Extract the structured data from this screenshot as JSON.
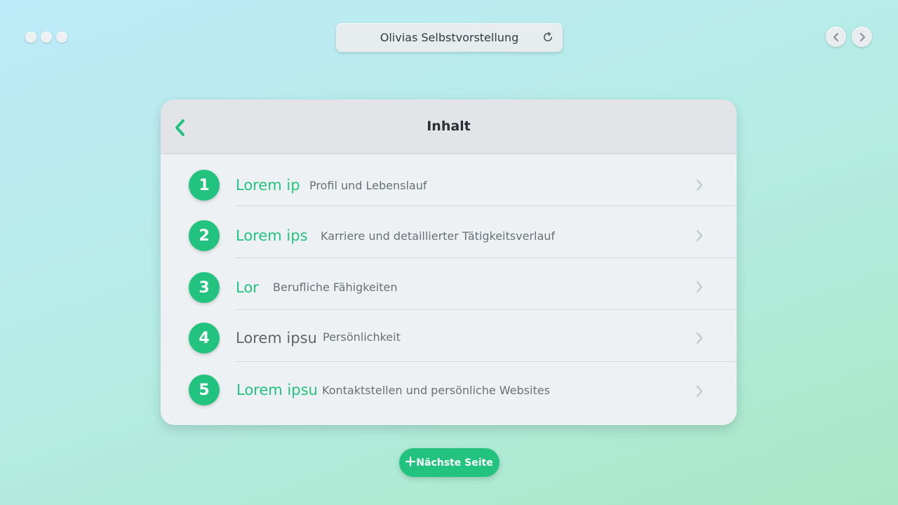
{
  "window": {
    "title": "Olivias Selbstvorstellung"
  },
  "icons": {
    "refresh": "refresh-icon",
    "back": "chevron-left-icon",
    "forward": "chevron-right-icon",
    "row_chevron": "chevron-right-icon",
    "next_plus": "plus-icon"
  },
  "colors": {
    "accent": "#22c37f",
    "header_bg": "#e3e4e8",
    "card_bg": "#edf1f3"
  },
  "card": {
    "title": "Inhalt",
    "items": [
      {
        "number": "1",
        "title": "Lorem ip",
        "description": "Profil und Lebenslauf"
      },
      {
        "number": "2",
        "title": "Lorem ips",
        "description": "Karriere und detaillierter Tätigkeitsverlauf"
      },
      {
        "number": "3",
        "title": "Lor",
        "description": "Berufliche Fähigkeiten"
      },
      {
        "number": "4",
        "title": "Lorem ipsu",
        "description": "Persönlichkeit"
      },
      {
        "number": "5",
        "title": "Lorem ipsu",
        "description": "Kontaktstellen und persönliche Websites"
      }
    ]
  },
  "footer": {
    "next_label": "Nächste Seite"
  }
}
